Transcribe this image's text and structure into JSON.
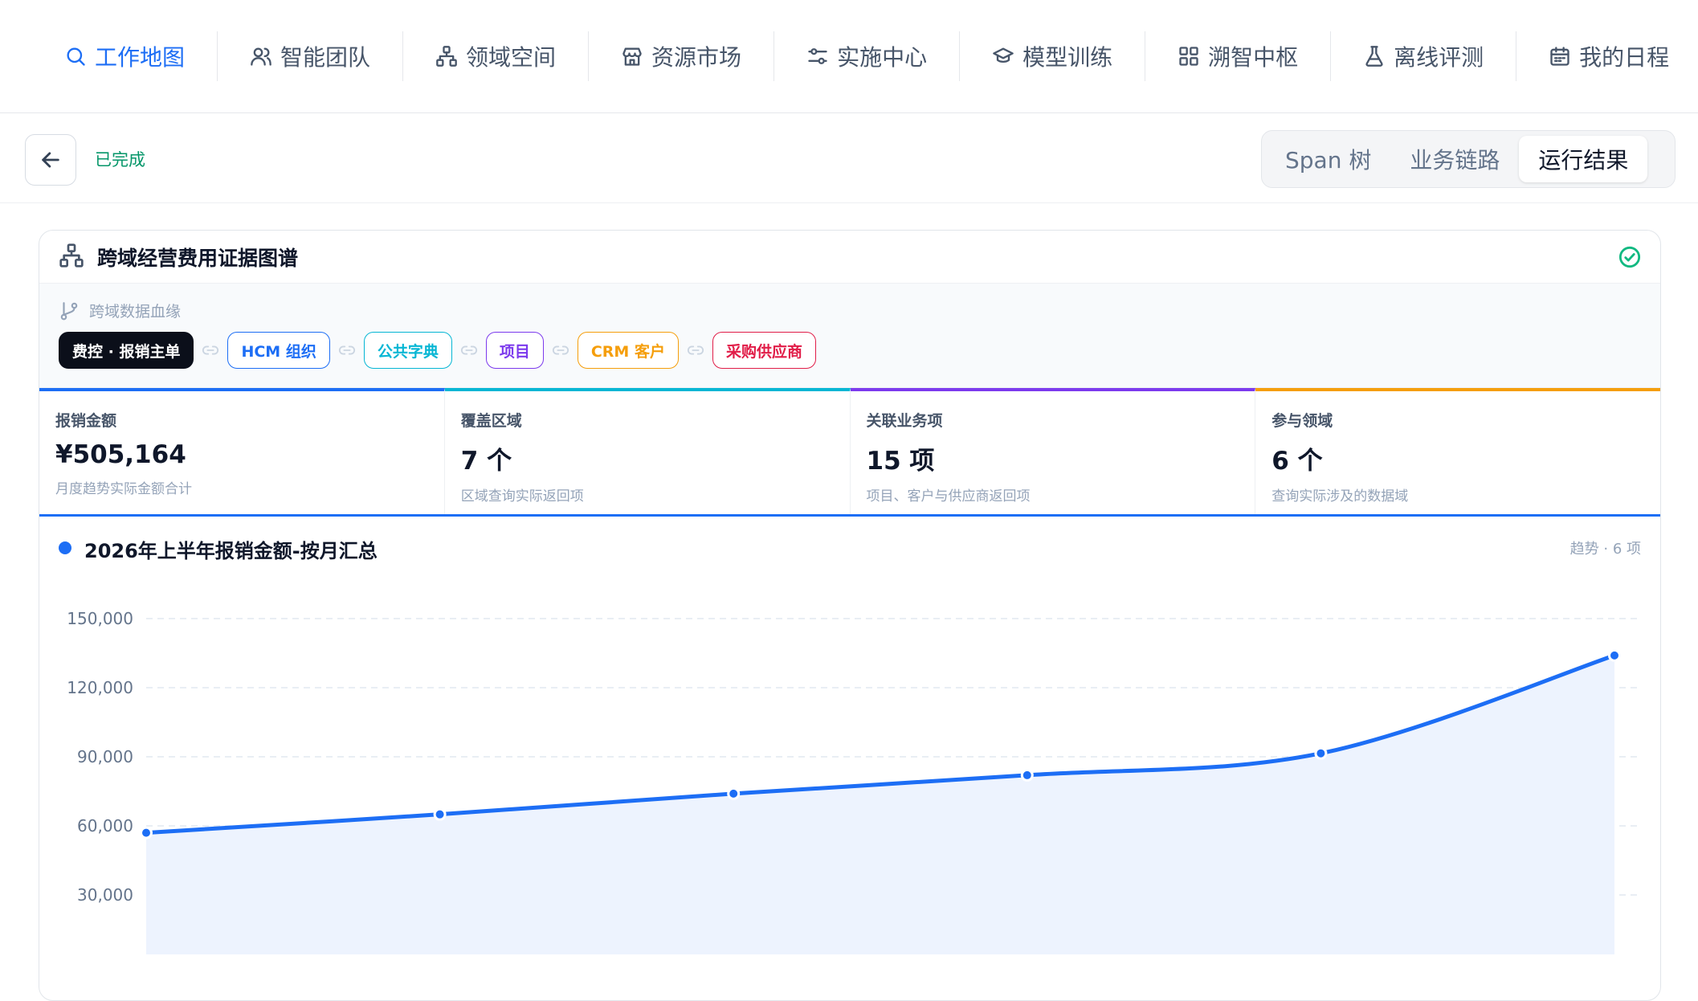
{
  "nav": {
    "items": [
      {
        "label": "工作地图",
        "icon": "search-icon",
        "active": true
      },
      {
        "label": "智能团队",
        "icon": "users-icon",
        "active": false
      },
      {
        "label": "领域空间",
        "icon": "hierarchy-icon",
        "active": false
      },
      {
        "label": "资源市场",
        "icon": "store-icon",
        "active": false
      },
      {
        "label": "实施中心",
        "icon": "sliders-icon",
        "active": false
      },
      {
        "label": "模型训练",
        "icon": "graduation-cap-icon",
        "active": false
      },
      {
        "label": "溯智中枢",
        "icon": "grid-icon",
        "active": false
      },
      {
        "label": "离线评测",
        "icon": "flask-icon",
        "active": false
      },
      {
        "label": "我的日程",
        "icon": "calendar-icon",
        "active": false
      }
    ]
  },
  "subheader": {
    "status": "已完成",
    "tabs": [
      {
        "label": "Span 树",
        "active": false
      },
      {
        "label": "业务链路",
        "active": false
      },
      {
        "label": "运行结果",
        "active": true
      }
    ]
  },
  "card": {
    "title": "跨域经营费用证据图谱",
    "lineage_label": "跨域数据血缘",
    "chips": [
      {
        "label": "费控 · 报销主单",
        "color": "#0b0f1a"
      },
      {
        "label": "HCM 组织",
        "color": "#1d6ef5"
      },
      {
        "label": "公共字典",
        "color": "#06b6d4"
      },
      {
        "label": "项目",
        "color": "#7c3aed"
      },
      {
        "label": "CRM 客户",
        "color": "#f59e0b"
      },
      {
        "label": "采购供应商",
        "color": "#e11d48"
      }
    ],
    "stats": [
      {
        "label": "报销金额",
        "value": "¥505,164",
        "sub": "月度趋势实际金额合计",
        "color": "#1d6ef5"
      },
      {
        "label": "覆盖区域",
        "value": "7 个",
        "sub": "区域查询实际返回项",
        "color": "#06b6d4"
      },
      {
        "label": "关联业务项",
        "value": "15 项",
        "sub": "项目、客户与供应商返回项",
        "color": "#7c3aed"
      },
      {
        "label": "参与领域",
        "value": "6 个",
        "sub": "查询实际涉及的数据域",
        "color": "#f59e0b"
      }
    ]
  },
  "chart_data": {
    "type": "area",
    "title": "2026年上半年报销金额-按月汇总",
    "meta": "趋势 · 6 项",
    "yticks": [
      150000,
      120000,
      90000,
      60000,
      30000
    ],
    "ytick_labels": [
      "150,000",
      "120,000",
      "90,000",
      "60,000",
      "30,000"
    ],
    "ylim": [
      0,
      150000
    ],
    "values": [
      57000,
      65000,
      74000,
      82000,
      91500,
      134000
    ],
    "color": "#1d6ef5",
    "fill": "#edf3fe"
  }
}
